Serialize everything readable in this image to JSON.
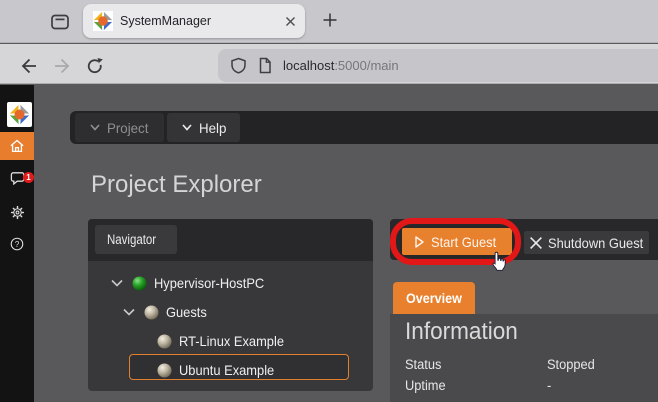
{
  "browser": {
    "tab_title": "SystemManager",
    "url_host": "localhost",
    "url_path": ":5000/main"
  },
  "sidebar": {
    "badge_count": "1"
  },
  "menubar": {
    "project_label": "Project",
    "help_label": "Help"
  },
  "page": {
    "title": "Project Explorer"
  },
  "navigator": {
    "header_label": "Navigator",
    "tree": [
      {
        "label": "Hypervisor-HostPC",
        "state": "green"
      },
      {
        "label": "Guests",
        "state": "gray"
      },
      {
        "label": "RT-Linux Example",
        "state": "gray"
      },
      {
        "label": "Ubuntu Example",
        "state": "gray",
        "selected": true
      }
    ]
  },
  "toolbar": {
    "start_label": "Start Guest",
    "shutdown_label": "Shutdown Guest"
  },
  "detail": {
    "tab_label": "Overview",
    "heading": "Information",
    "rows": [
      {
        "label": "Status",
        "value": "Stopped"
      },
      {
        "label": "Uptime",
        "value": "-"
      }
    ]
  },
  "colors": {
    "accent_orange": "#e8802d",
    "annotation_red": "#e21717",
    "badge_red": "#e01b1b",
    "status_green": "#2fae2f"
  }
}
